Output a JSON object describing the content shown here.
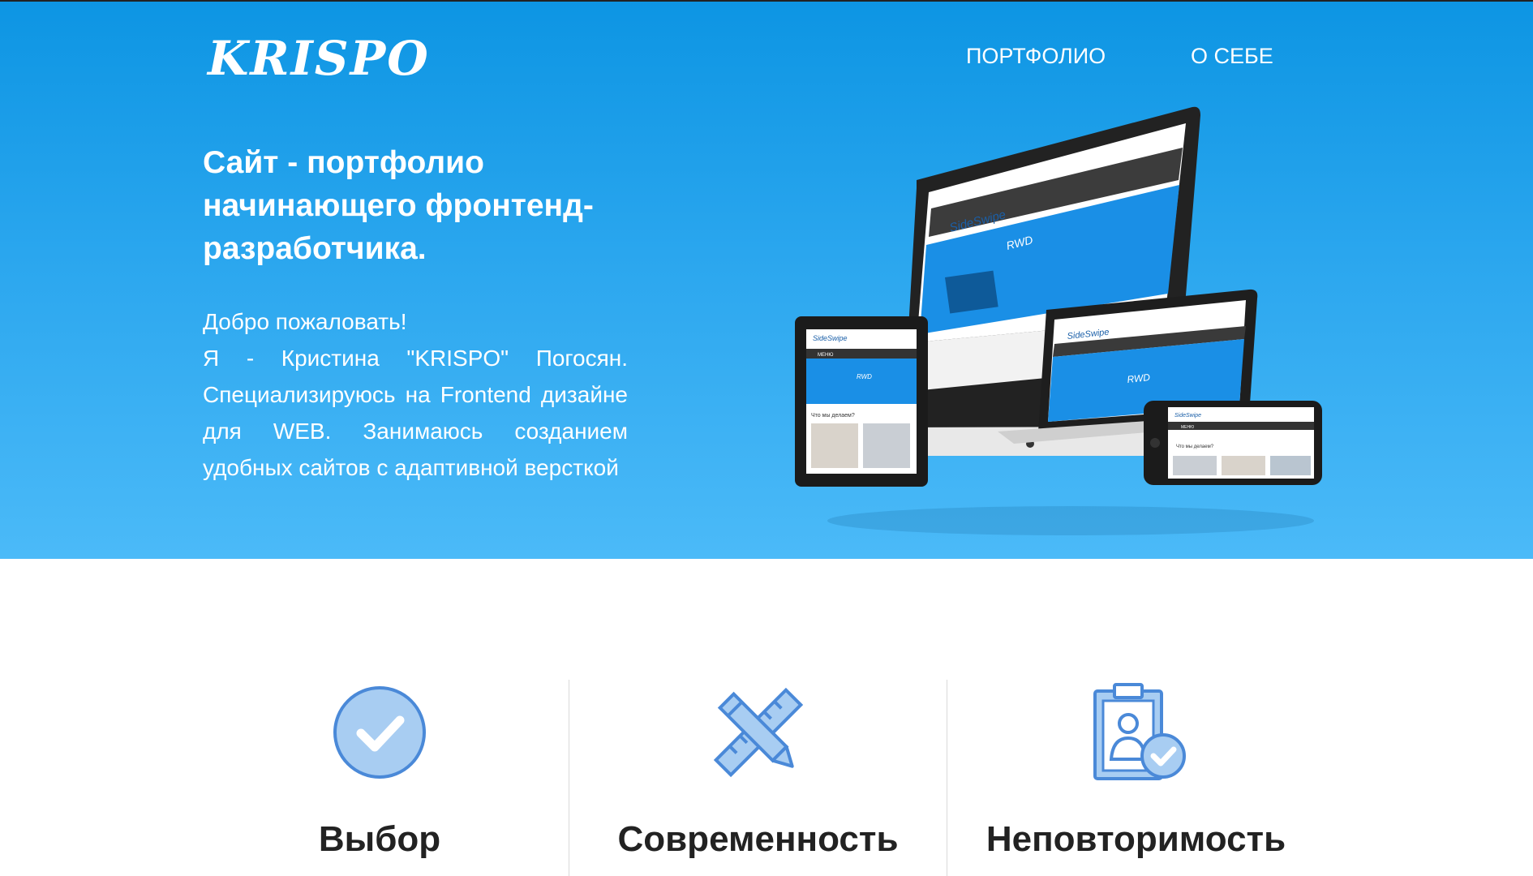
{
  "header": {
    "logo": "KRISPO",
    "nav": [
      "ПОРТФОЛИО",
      "О СЕБЕ"
    ]
  },
  "hero": {
    "headline": "Сайт - портфолио начинающего фронтенд-разработчика.",
    "greeting": "Добро пожаловать!",
    "body": "Я - Кристина \"KRISPO\" Погосян. Специализируюсь на Frontend дизайне для WEB. Занимаюсь созданием удобных сайтов с адаптивной версткой"
  },
  "devices_mockup": {
    "brand": "SideSwipe",
    "banner": "RWD",
    "menu_label": "МЕНЮ",
    "section_label": "Что мы делаем?"
  },
  "features": [
    {
      "title": "Выбор",
      "icon": "check-circle-icon"
    },
    {
      "title": "Современность",
      "icon": "ruler-pencil-icon"
    },
    {
      "title": "Неповторимость",
      "icon": "clipboard-user-check-icon"
    }
  ],
  "colors": {
    "hero_top": "#0d95e3",
    "hero_bottom": "#4bbaf8",
    "icon_fill": "#a8cdf2",
    "icon_stroke": "#4a89d8"
  }
}
